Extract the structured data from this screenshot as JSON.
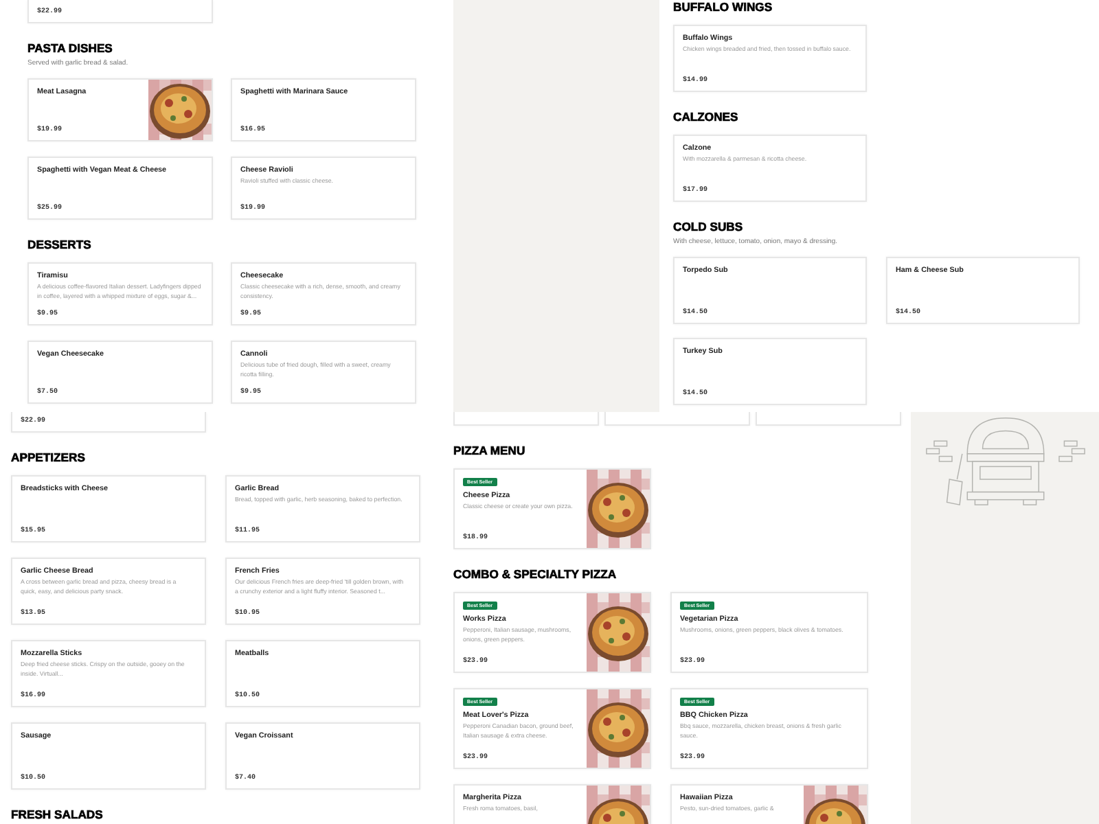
{
  "panels": [
    {
      "lead_cards": [
        {
          "price": "$22.99"
        }
      ],
      "sections": [
        {
          "title": "PASTA DISHES",
          "subtitle": "Served with garlic bread & salad.",
          "items": [
            {
              "name": "Meat Lasagna",
              "price": "$19.99",
              "has_picture": true
            },
            {
              "name": "Spaghetti with Marinara Sauce",
              "price": "$16.95"
            },
            {
              "name": "Spaghetti with Vegan Meat & Cheese",
              "price": "$25.99"
            },
            {
              "name": "Cheese Ravioli",
              "description": "Ravioli stuffed with classic cheese.",
              "price": "$19.99"
            }
          ]
        },
        {
          "title": "DESSERTS",
          "items": [
            {
              "name": "Tiramisu",
              "description": "A delicious coffee-flavored Italian dessert. Ladyfingers dipped in coffee, layered with a whipped mixture of eggs, sugar &...",
              "price": "$9.95"
            },
            {
              "name": "Cheesecake",
              "description": "Classic cheesecake with a rich, dense, smooth, and creamy consistency.",
              "price": "$9.95"
            },
            {
              "name": "Vegan Cheesecake",
              "price": "$7.50"
            },
            {
              "name": "Cannoli",
              "description": "Delicious tube of fried dough, filled with a sweet, creamy ricotta filling.",
              "price": "$9.95"
            }
          ]
        }
      ]
    },
    {
      "sections": [
        {
          "title": "BUFFALO WINGS",
          "items": [
            {
              "name": "Buffalo Wings",
              "description": "Chicken wings breaded and fried, then tossed in buffalo sauce.",
              "price": "$14.99"
            }
          ]
        },
        {
          "title": "CALZONES",
          "items": [
            {
              "name": "Calzone",
              "description": "With mozzarella & parmesan & ricotta cheese.",
              "price": "$17.99"
            }
          ]
        },
        {
          "title": "COLD SUBS",
          "subtitle": "With cheese, lettuce, tomato, onion, mayo & dressing.",
          "items": [
            {
              "name": "Torpedo Sub",
              "price": "$14.50"
            },
            {
              "name": "Ham & Cheese Sub",
              "price": "$14.50"
            },
            {
              "name": "Turkey Sub",
              "price": "$14.50"
            }
          ]
        }
      ]
    },
    {
      "lead_cards": [
        {
          "price": "$22.99"
        }
      ],
      "sections": [
        {
          "title": "APPETIZERS",
          "items": [
            {
              "name": "Breadsticks with Cheese",
              "price": "$15.95"
            },
            {
              "name": "Garlic Bread",
              "description": "Bread, topped with garlic, herb seasoning, baked to perfection.",
              "price": "$11.95"
            },
            {
              "name": "Garlic Cheese Bread",
              "description": "A cross between garlic bread and pizza, cheesy bread is a quick, easy, and delicious party snack.",
              "price": "$13.95"
            },
            {
              "name": "French Fries",
              "description": "Our delicious French fries are deep-fried 'till golden brown, with a crunchy exterior and a light fluffy interior. Seasoned t...",
              "price": "$10.95"
            },
            {
              "name": "Mozzarella Sticks",
              "description": "Deep fried cheese sticks. Crispy on the outside, gooey on the inside. Virtuall...",
              "price": "$16.99"
            },
            {
              "name": "Meatballs",
              "price": "$10.50"
            },
            {
              "name": "Sausage",
              "price": "$10.50"
            },
            {
              "name": "Vegan Croissant",
              "price": "$7.40"
            }
          ]
        },
        {
          "title": "FRESH SALADS"
        }
      ]
    },
    {
      "lead_cards": [
        {
          "kind": "card"
        },
        {
          "kind": "card"
        },
        {
          "kind": "card"
        }
      ],
      "sections": [
        {
          "title": "PIZZA MENU",
          "items": [
            {
              "badge": "Best Seller",
              "name": "Cheese Pizza",
              "description": "Classic cheese or create your own pizza.",
              "price": "$18.99",
              "has_picture": true
            }
          ]
        },
        {
          "title": "COMBO & SPECIALTY PIZZA",
          "items": [
            {
              "badge": "Best Seller",
              "name": "Works Pizza",
              "description": "Pepperoni, Italian sausage, mushrooms, onions, green peppers.",
              "price": "$23.99",
              "has_picture": true
            },
            {
              "badge": "Best Seller",
              "name": "Vegetarian Pizza",
              "description": "Mushrooms, onions, green peppers, black olives & tomatoes.",
              "price": "$23.99"
            },
            {
              "badge": "Best Seller",
              "name": "Meat Lover's Pizza",
              "description": "Pepperoni Canadian bacon, ground beef, Italian sausage & extra cheese.",
              "price": "$23.99",
              "has_picture": true
            },
            {
              "badge": "Best Seller",
              "name": "BBQ Chicken Pizza",
              "description": "Bbq sauce, mozzarella, chicken breast, onions & fresh garlic sauce.",
              "price": "$23.99"
            },
            {
              "name": "Margherita Pizza",
              "description": "Fresh roma tomatoes, basil,",
              "has_picture": true
            },
            {
              "name": "Hawaiian Pizza",
              "description": "Pesto, sun-dried tomatoes, garlic &",
              "has_picture": true
            }
          ]
        }
      ]
    }
  ],
  "illustration": {
    "kind": "oven"
  }
}
